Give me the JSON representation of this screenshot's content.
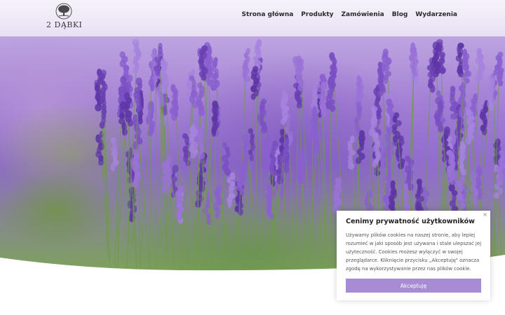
{
  "brand": {
    "logo_text": "2 DĄBKI",
    "logo_icon": "tree-icon"
  },
  "nav": {
    "items": [
      "Strona główna",
      "Produkty",
      "Zamówienia",
      "Blog",
      "Wydarzenia"
    ]
  },
  "hero": {
    "image": "lavender-field"
  },
  "cookie": {
    "title": "Cenimy prywatność użytkowników",
    "body_lines": [
      "Używamy plików cookies na naszej stronie, aby lepiej",
      "rozumieć w jaki sposób jest używana i stale ulepszać jej",
      "użyteczność. Cookies możesz wyłączyć w swojej",
      "przeglądarce. Kliknięcie przycisku „Akceptuję\" oznacza",
      "zgodę na wykorzystywanie przez nas plików cookie."
    ],
    "accept_label": "Akceptuję",
    "close_label": "×",
    "accent_color": "#a78bd4"
  }
}
